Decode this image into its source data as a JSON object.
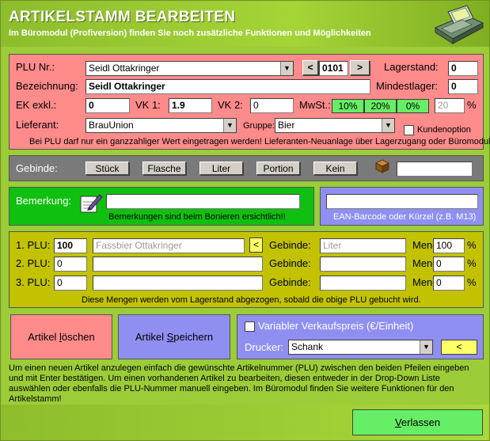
{
  "header": {
    "title": "ARTIKELSTAMM BEARBEITEN",
    "subtitle": "Im Büromodul (Profiversion) finden Sie noch zusätzliche Funktionen und Möglichkeiten"
  },
  "article": {
    "plu_label": "PLU Nr.:",
    "plu_select": "Seidl Ottakringer",
    "prev_label": "<",
    "plu_number": "0101",
    "next_label": ">",
    "lagerstand_label": "Lagerstand:",
    "lagerstand": "0",
    "bezeichnung_label": "Bezeichnung:",
    "bezeichnung": "Seidl Ottakringer",
    "mindestlager_label": "Mindestlager:",
    "mindestlager": "0",
    "ek_label": "EK exkl.:",
    "ek": "0",
    "vk1_label": "VK 1:",
    "vk1": "1.9",
    "vk2_label": "VK 2:",
    "vk2": "0",
    "mwst_label": "MwSt.:",
    "mwst_options": [
      "10%",
      "20%",
      "0%"
    ],
    "mwst_value": "20",
    "percent": "%",
    "lieferant_label": "Lieferant:",
    "lieferant": "BrauUnion",
    "gruppe_label": "Gruppe:",
    "gruppe": "Bier",
    "kundenoption_label": "Kundenoption",
    "hint": "Bei PLU darf nur ein ganzzahliger Wert eingetragen werden! Lieferanten-Neuanlage über Lagerzugang oder Büromodul!"
  },
  "gebinde": {
    "label": "Gebinde:",
    "buttons": [
      "Stück",
      "Flasche",
      "Liter",
      "Portion",
      "Kein"
    ],
    "value": ""
  },
  "bemerkung": {
    "label": "Bemerkung:",
    "value": "",
    "hint": "Bemerkungen sind beim Bonieren ersichtlich!!"
  },
  "ean": {
    "value": "",
    "hint": "EAN-Barcode oder Kürzel (z.B. M13)"
  },
  "plu_links": {
    "rows": [
      {
        "label": "1. PLU:",
        "plu": "100",
        "name": "Fassbier Ottakringer",
        "gebinde_label": "Gebinde:",
        "gebinde": "Liter",
        "menge_label": "Menge:",
        "menge": "100",
        "pct": "%"
      },
      {
        "label": "2. PLU:",
        "plu": "0",
        "name": "",
        "gebinde_label": "Gebinde:",
        "gebinde": "",
        "menge_label": "Menge:",
        "menge": "0",
        "pct": "%"
      },
      {
        "label": "3. PLU:",
        "plu": "0",
        "name": "",
        "gebinde_label": "Gebinde:",
        "gebinde": "",
        "menge_label": "Menge:",
        "menge": "0",
        "pct": "%"
      }
    ],
    "back_label": "<",
    "hint": "Diese Mengen werden vom Lagerstand abgezogen, sobald die obige PLU gebucht wird."
  },
  "actions": {
    "delete_pre": "Artikel ",
    "delete_u": "l",
    "delete_post": "öschen",
    "save_pre": "Artikel ",
    "save_u": "S",
    "save_post": "peichern"
  },
  "options": {
    "variable_price_label": "Variabler Verkaufspreis (€/Einheit)",
    "drucker_label": "Drucker:",
    "drucker": "Schank",
    "back_label": "<"
  },
  "info_text": "Um einen neuen Artikel anzulegen einfach die gewünschte Artikelnummer (PLU) zwischen den beiden Pfeilen eingeben und mit Enter bestätigen. Um einen vorhandenen Artikel zu bearbeiten, diesen entweder in der Drop-Down Liste auswählen oder ebenfalls die PLU-Nummer manuell eingeben.  Im Büromodul finden Sie weitere Funktionen für den Artikelstamm!",
  "footer": {
    "leave_u": "V",
    "leave_post": "erlassen"
  }
}
